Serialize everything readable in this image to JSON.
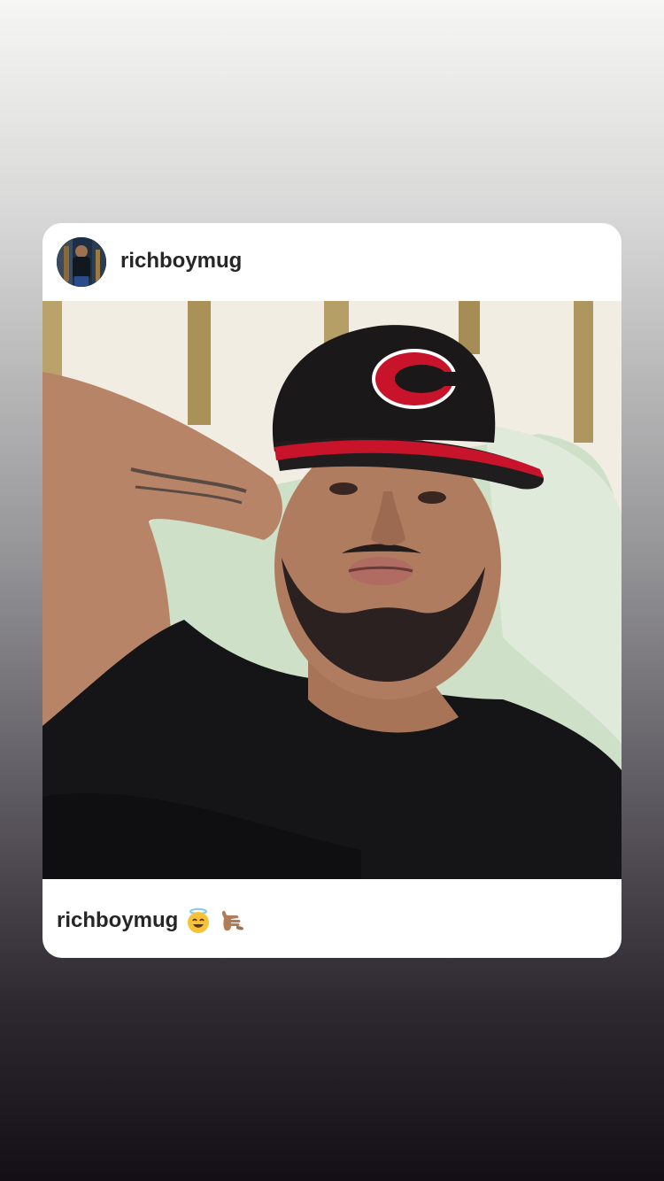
{
  "story": {
    "shared_post": {
      "header": {
        "username": "richboymug",
        "avatar_icon": "profile-avatar"
      },
      "photo": {
        "icon": "selfie-photo",
        "description_icons": [
          "baseball-cap-icon",
          "reds-c-logo"
        ]
      },
      "caption": {
        "username": "richboymug",
        "emojis": [
          "smiling-face-with-halo",
          "call-me-hand-medium-skin-tone"
        ]
      }
    }
  },
  "colors": {
    "card_background": "#ffffff",
    "text_primary": "#262626",
    "background_top": "#f6f6f3",
    "background_bottom": "#140e17",
    "cap_red": "#c8142b"
  }
}
